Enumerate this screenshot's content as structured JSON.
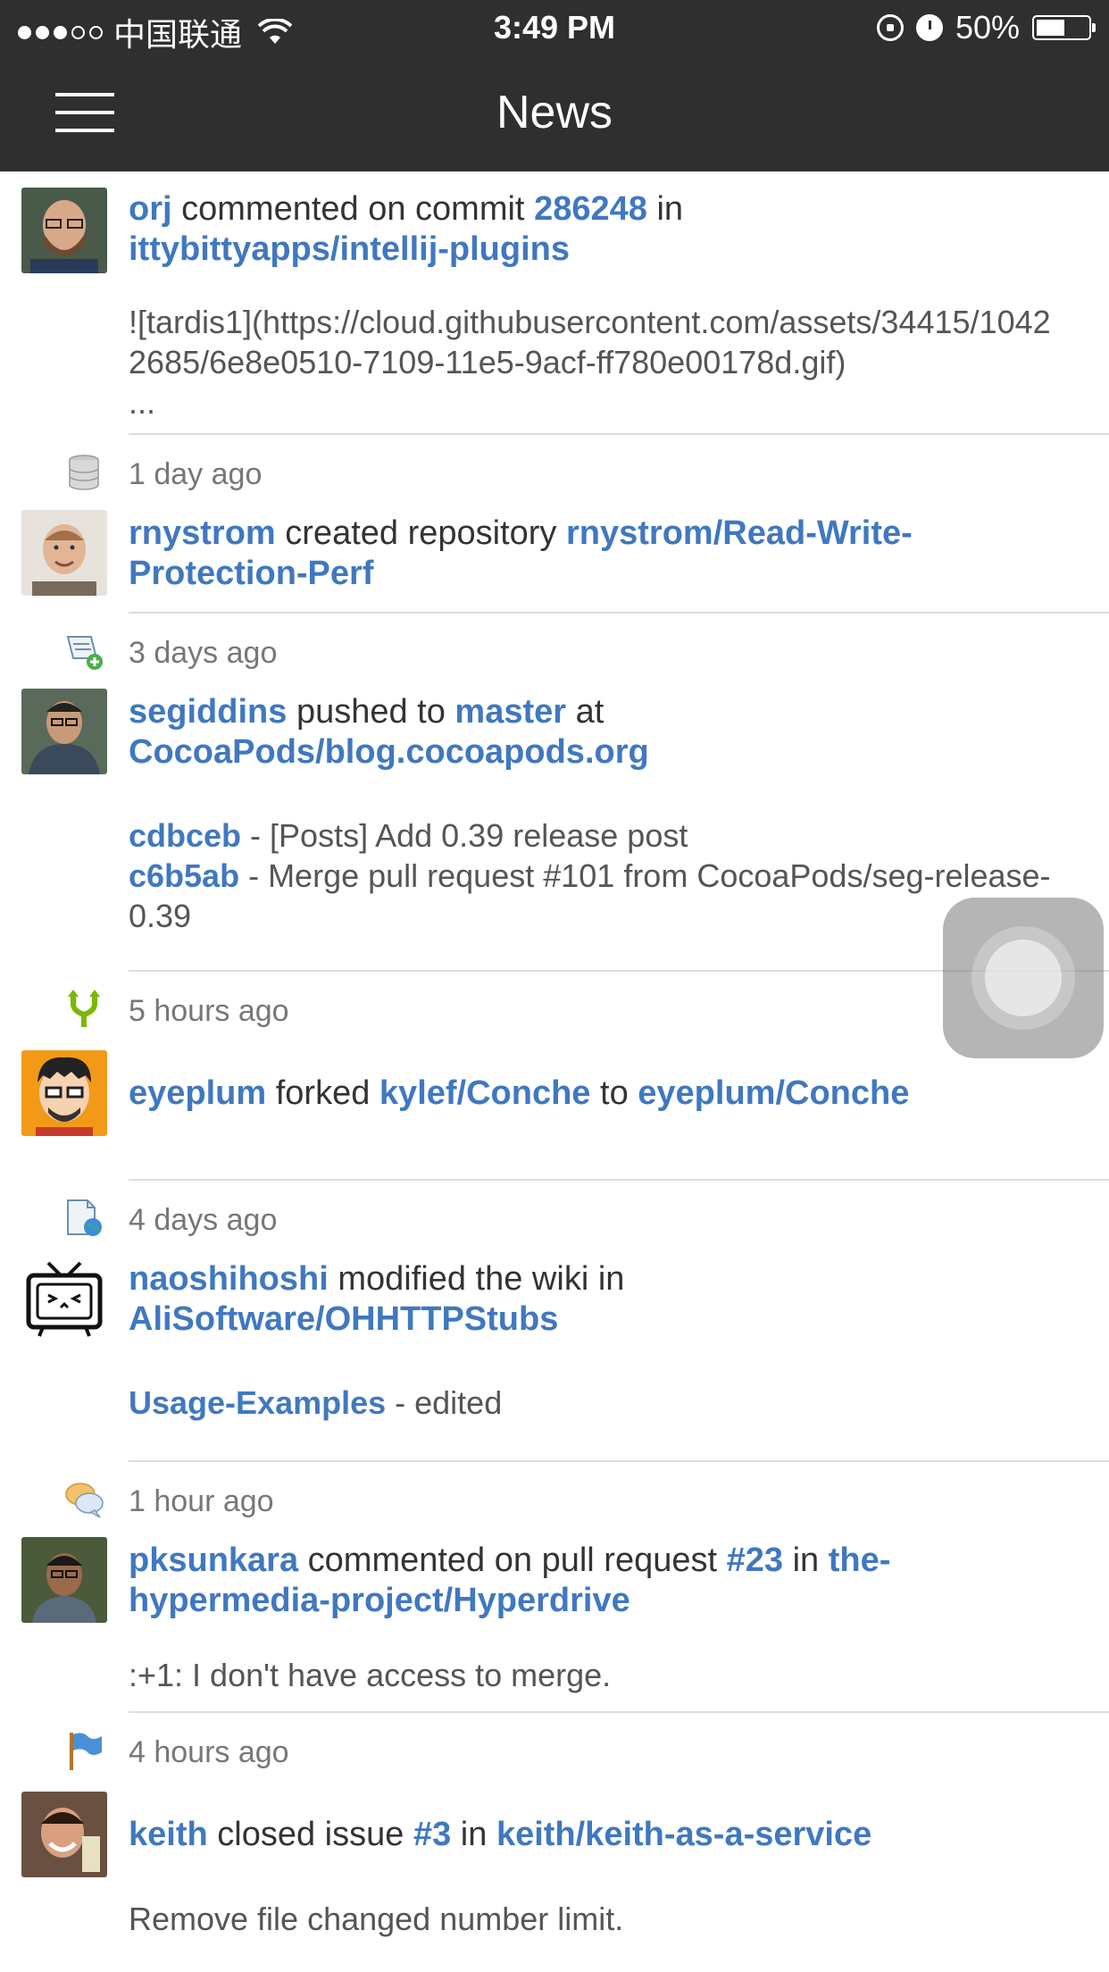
{
  "status_bar": {
    "carrier": "中国联通",
    "time": "3:49 PM",
    "battery": "50%",
    "battery_level": 0.5
  },
  "nav": {
    "title": "News"
  },
  "events": [
    {
      "user": "orj",
      "action": "commented on commit",
      "target1": "286248",
      "joiner": "in",
      "target2": "ittybittyapps/intellij-plugins",
      "body": "![tardis1](https://cloud.githubusercontent.com/assets/34415/10422685/6e8e0510-7109-11e5-9acf-ff780e00178d.gif)",
      "ellipsis": "...",
      "time": "1 day ago",
      "icon": "repo-icon"
    },
    {
      "user": "rnystrom",
      "action": "created repository",
      "target1": "rnystrom/Read-Write-Protection-Perf",
      "time": "3 days ago",
      "icon": "push-icon"
    },
    {
      "user": "segiddins",
      "action": "pushed to",
      "target1": "master",
      "joiner": "at",
      "target2": "CocoaPods/blog.cocoapods.org",
      "commits": [
        {
          "sha": "cdbceb",
          "msg": " - [Posts] Add 0.39 release post"
        },
        {
          "sha": "c6b5ab",
          "msg": " - Merge pull request #101 from CocoaPods/seg-release-0.39"
        }
      ],
      "time": "5 hours ago",
      "icon": "fork-icon"
    },
    {
      "user": "eyeplum",
      "action": "forked",
      "target1": "kylef/Conche",
      "joiner": "to",
      "target2": "eyeplum/Conche",
      "time": "4 days ago",
      "icon": "wiki-icon"
    },
    {
      "user": "naoshihoshi",
      "action": "modified the wiki in",
      "target1": "AliSoftware/OHHTTPStubs",
      "page": "Usage-Examples",
      "page_suffix": " - edited",
      "time": "1 hour ago",
      "icon": "comment-icon"
    },
    {
      "user": "pksunkara",
      "action": "commented on pull request",
      "target1": "#23",
      "joiner": "in",
      "target2": "the-hypermedia-project/Hyperdrive",
      "body": ":+1: I don't have access to merge.",
      "time": "4 hours ago",
      "icon": "issue-closed-icon"
    },
    {
      "user": "keith",
      "action": "closed issue",
      "target1": "#3",
      "joiner": "in",
      "target2": "keith/keith-as-a-service",
      "body": "Remove file changed number limit."
    }
  ]
}
